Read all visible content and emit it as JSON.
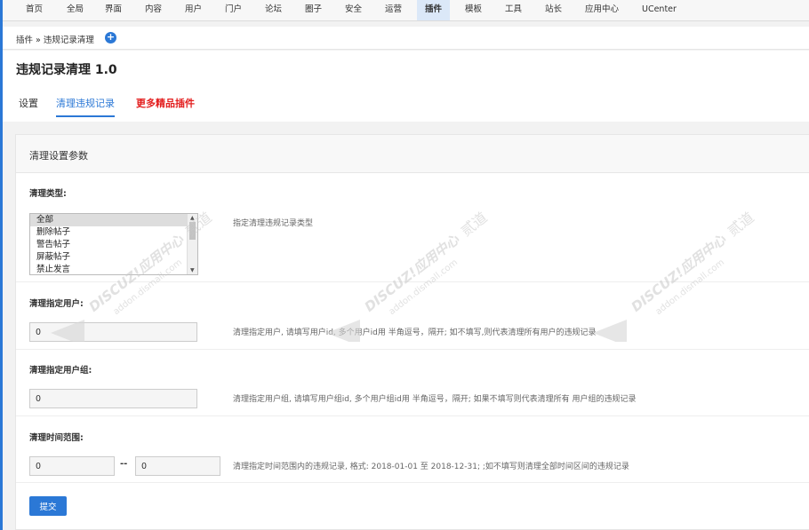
{
  "nav": [
    "首页",
    "全局",
    "界面",
    "内容",
    "用户",
    "门户",
    "论坛",
    "圈子",
    "安全",
    "运营",
    "插件",
    "模板",
    "工具",
    "站长",
    "应用中心",
    "UCenter"
  ],
  "breadcrumb": "插件 » 违规记录清理",
  "page_title": "违规记录清理 1.0",
  "tabs": {
    "settings": "设置",
    "clean": "清理违规记录",
    "more": "更多精品插件"
  },
  "panel_title": "清理设置参数",
  "form": {
    "type": {
      "label": "清理类型:",
      "options": [
        "全部",
        "删除帖子",
        "警告帖子",
        "屏蔽帖子",
        "禁止发言"
      ],
      "desc": "指定清理违规记录类型"
    },
    "user": {
      "label": "清理指定用户:",
      "value": "0",
      "desc": "清理指定用户, 请填写用户id, 多个用户id用 半角逗号，隔开; 如不填写,则代表清理所有用户的违规记录"
    },
    "group": {
      "label": "清理指定用户组:",
      "value": "0",
      "desc": "清理指定用户组, 请填写用户组id, 多个用户组id用 半角逗号，隔开; 如果不填写则代表清理所有 用户组的违规记录"
    },
    "time": {
      "label": "清理时间范围:",
      "from": "0",
      "to": "0",
      "sep": "--",
      "desc": "清理指定时间范围内的违规记录, 格式: 2018-01-01 至 2018-12-31; ;如不填写则清理全部时间区间的违规记录"
    },
    "submit": "提交"
  },
  "watermark": {
    "brand": "DISCUZ!应用中心",
    "domain": "addon.dismall.com",
    "mark": "贰道"
  },
  "colors": {
    "accent": "#2b78d6",
    "promo": "#e31e1e"
  }
}
